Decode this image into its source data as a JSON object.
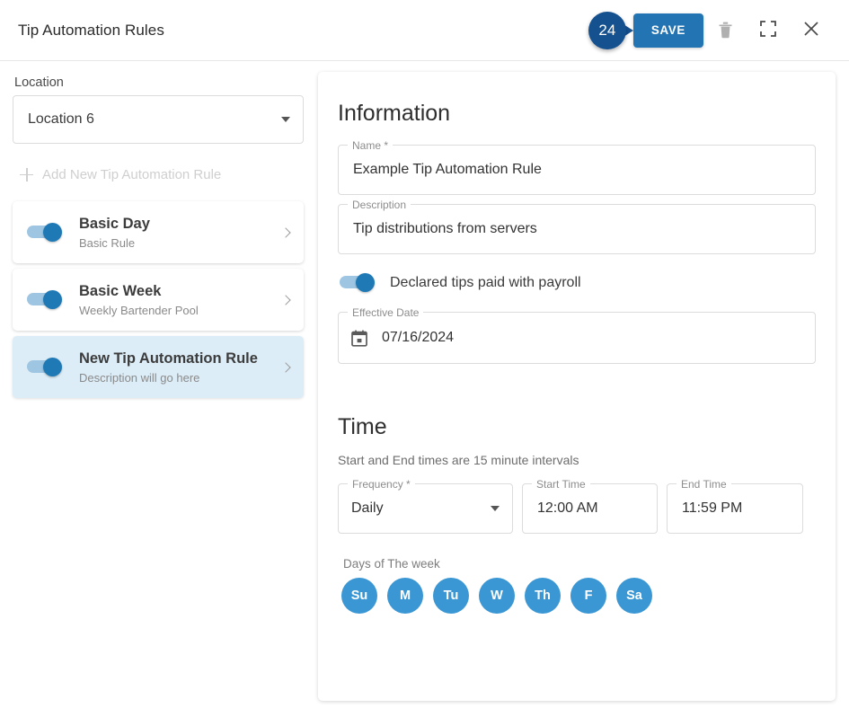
{
  "header": {
    "title": "Tip Automation Rules",
    "badge_count": "24",
    "save_label": "SAVE",
    "delete_icon": "trash-icon",
    "fullscreen_icon": "fullscreen-icon",
    "close_icon": "close-icon"
  },
  "sidebar": {
    "location_label": "Location",
    "location_value": "Location 6",
    "add_rule_label": "Add New Tip Automation Rule",
    "rules": [
      {
        "title": "Basic Day",
        "subtitle": "Basic Rule",
        "enabled": true,
        "selected": false
      },
      {
        "title": "Basic Week",
        "subtitle": "Weekly Bartender Pool",
        "enabled": true,
        "selected": false
      },
      {
        "title": "New Tip Automation Rule",
        "subtitle": "Description will go here",
        "enabled": true,
        "selected": true
      }
    ]
  },
  "information": {
    "section_title": "Information",
    "name_label": "Name *",
    "name_value": "Example Tip Automation Rule",
    "description_label": "Description",
    "description_value": "Tip distributions from servers",
    "declared_tips_label": "Declared tips paid with payroll",
    "declared_tips_on": true,
    "effective_date_label": "Effective Date",
    "effective_date_value": "07/16/2024"
  },
  "time": {
    "section_title": "Time",
    "note": "Start and End times are 15 minute intervals",
    "frequency_label": "Frequency *",
    "frequency_value": "Daily",
    "start_label": "Start Time",
    "start_value": "12:00 AM",
    "end_label": "End Time",
    "end_value": "11:59 PM",
    "days_label": "Days of The week",
    "days": [
      "Su",
      "M",
      "Tu",
      "W",
      "Th",
      "F",
      "Sa"
    ]
  },
  "colors": {
    "badge_blue": "#15508f",
    "save_blue": "#2274b3",
    "toggle_thumb": "#1f79b5",
    "toggle_track": "#9ec6e3",
    "day_circle": "#3a97d4",
    "selected_row": "#dcedf7"
  }
}
